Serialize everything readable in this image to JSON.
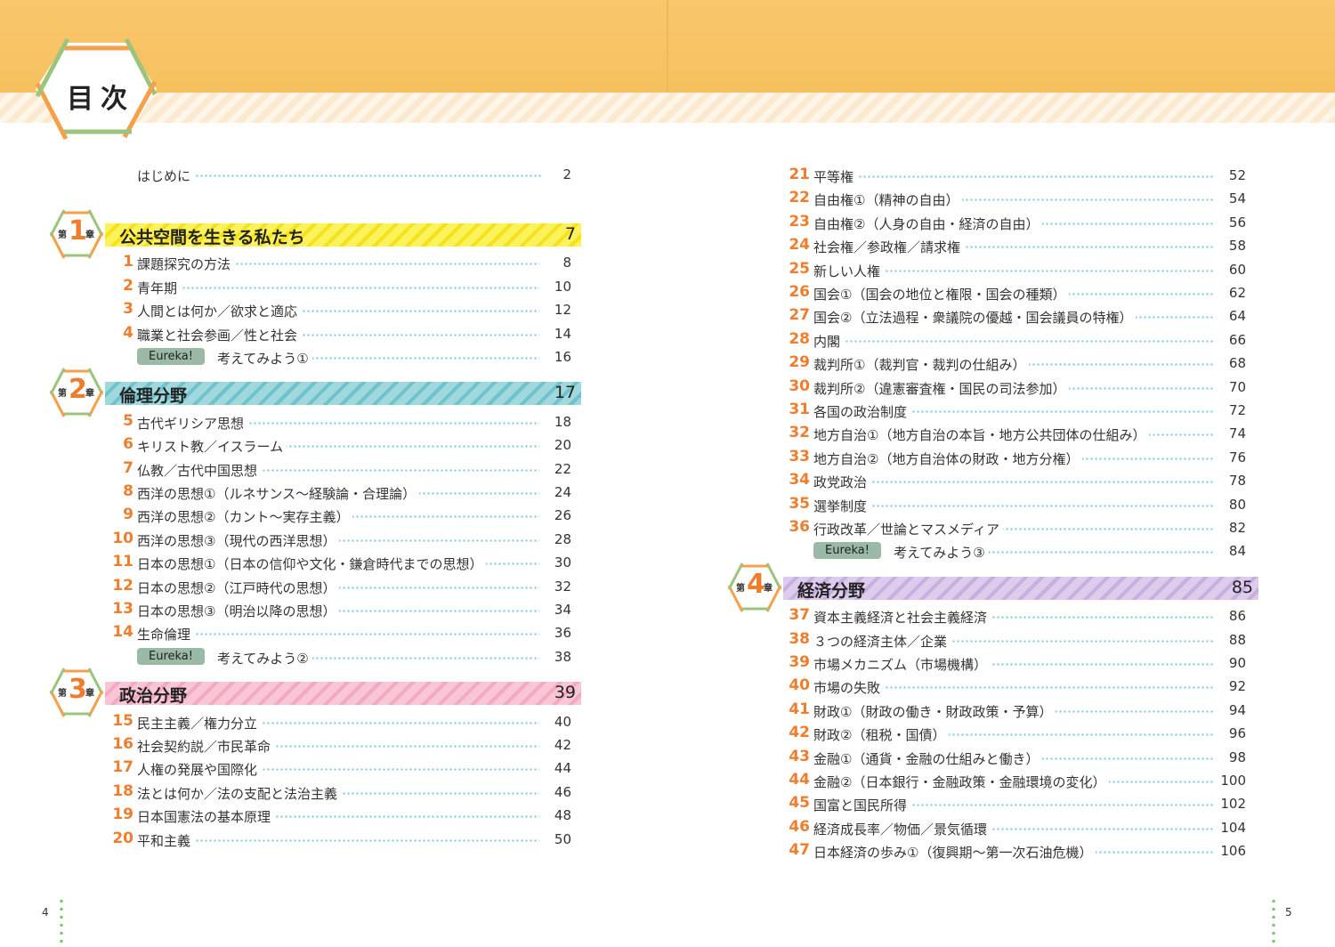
{
  "title": "目次",
  "intro": {
    "label": "はじめに",
    "page": "2"
  },
  "left_column": [
    {
      "kind": "chapter",
      "chapter_num": "1",
      "chapter_prefix": "第",
      "chapter_suffix": "章",
      "title": "公共空間を生きる私たち",
      "page": "7",
      "bar_color": "#fbf35a",
      "accent": "#f6e11c"
    },
    {
      "kind": "item",
      "num": "1",
      "label": "課題探究の方法",
      "page": "8"
    },
    {
      "kind": "item",
      "num": "2",
      "label": "青年期",
      "page": "10"
    },
    {
      "kind": "item",
      "num": "3",
      "label": "人間とは何か／欲求と適応",
      "page": "12"
    },
    {
      "kind": "item",
      "num": "4",
      "label": "職業と社会参画／性と社会",
      "page": "14"
    },
    {
      "kind": "eureka",
      "badge": "Eureka!",
      "label": "考えてみよう①",
      "page": "16"
    },
    {
      "kind": "chapter",
      "chapter_num": "2",
      "chapter_prefix": "第",
      "chapter_suffix": "章",
      "title": "倫理分野",
      "page": "17",
      "bar_color": "#9fd8dd",
      "accent": "#6fc3cc"
    },
    {
      "kind": "item",
      "num": "5",
      "label": "古代ギリシア思想",
      "page": "18"
    },
    {
      "kind": "item",
      "num": "6",
      "label": "キリスト教／イスラーム",
      "page": "20"
    },
    {
      "kind": "item",
      "num": "7",
      "label": "仏教／古代中国思想",
      "page": "22"
    },
    {
      "kind": "item",
      "num": "8",
      "label": "西洋の思想①（ルネサンス〜経験論・合理論）",
      "page": "24"
    },
    {
      "kind": "item",
      "num": "9",
      "label": "西洋の思想②（カント〜実存主義）",
      "page": "26"
    },
    {
      "kind": "item",
      "num": "10",
      "label": "西洋の思想③（現代の西洋思想）",
      "page": "28"
    },
    {
      "kind": "item",
      "num": "11",
      "label": "日本の思想①（日本の信仰や文化・鎌倉時代までの思想）",
      "page": "30"
    },
    {
      "kind": "item",
      "num": "12",
      "label": "日本の思想②（江戸時代の思想）",
      "page": "32"
    },
    {
      "kind": "item",
      "num": "13",
      "label": "日本の思想③（明治以降の思想）",
      "page": "34"
    },
    {
      "kind": "item",
      "num": "14",
      "label": "生命倫理",
      "page": "36"
    },
    {
      "kind": "eureka",
      "badge": "Eureka!",
      "label": "考えてみよう②",
      "page": "38"
    },
    {
      "kind": "chapter",
      "chapter_num": "3",
      "chapter_prefix": "第",
      "chapter_suffix": "章",
      "title": "政治分野",
      "page": "39",
      "bar_color": "#f8c6d6",
      "accent": "#f3a9c0"
    },
    {
      "kind": "item",
      "num": "15",
      "label": "民主主義／権力分立",
      "page": "40"
    },
    {
      "kind": "item",
      "num": "16",
      "label": "社会契約説／市民革命",
      "page": "42"
    },
    {
      "kind": "item",
      "num": "17",
      "label": "人権の発展や国際化",
      "page": "44"
    },
    {
      "kind": "item",
      "num": "18",
      "label": "法とは何か／法の支配と法治主義",
      "page": "46"
    },
    {
      "kind": "item",
      "num": "19",
      "label": "日本国憲法の基本原理",
      "page": "48"
    },
    {
      "kind": "item",
      "num": "20",
      "label": "平和主義",
      "page": "50"
    }
  ],
  "right_column": [
    {
      "kind": "item",
      "num": "21",
      "label": "平等権",
      "page": "52"
    },
    {
      "kind": "item",
      "num": "22",
      "label": "自由権①（精神の自由）",
      "page": "54"
    },
    {
      "kind": "item",
      "num": "23",
      "label": "自由権②（人身の自由・経済の自由）",
      "page": "56"
    },
    {
      "kind": "item",
      "num": "24",
      "label": "社会権／参政権／請求権",
      "page": "58"
    },
    {
      "kind": "item",
      "num": "25",
      "label": "新しい人権",
      "page": "60"
    },
    {
      "kind": "item",
      "num": "26",
      "label": "国会①（国会の地位と権限・国会の種類）",
      "page": "62"
    },
    {
      "kind": "item",
      "num": "27",
      "label": "国会②（立法過程・衆議院の優越・国会議員の特権）",
      "page": "64"
    },
    {
      "kind": "item",
      "num": "28",
      "label": "内閣",
      "page": "66"
    },
    {
      "kind": "item",
      "num": "29",
      "label": "裁判所①（裁判官・裁判の仕組み）",
      "page": "68"
    },
    {
      "kind": "item",
      "num": "30",
      "label": "裁判所②（違憲審査権・国民の司法参加）",
      "page": "70"
    },
    {
      "kind": "item",
      "num": "31",
      "label": "各国の政治制度",
      "page": "72"
    },
    {
      "kind": "item",
      "num": "32",
      "label": "地方自治①（地方自治の本旨・地方公共団体の仕組み）",
      "page": "74"
    },
    {
      "kind": "item",
      "num": "33",
      "label": "地方自治②（地方自治体の財政・地方分権）",
      "page": "76"
    },
    {
      "kind": "item",
      "num": "34",
      "label": "政党政治",
      "page": "78"
    },
    {
      "kind": "item",
      "num": "35",
      "label": "選挙制度",
      "page": "80"
    },
    {
      "kind": "item",
      "num": "36",
      "label": "行政改革／世論とマスメディア",
      "page": "82"
    },
    {
      "kind": "eureka",
      "badge": "Eureka!",
      "label": "考えてみよう③",
      "page": "84"
    },
    {
      "kind": "chapter",
      "chapter_num": "4",
      "chapter_prefix": "第",
      "chapter_suffix": "章",
      "title": "経済分野",
      "page": "85",
      "bar_color": "#ddccec",
      "accent": "#c7b0e0"
    },
    {
      "kind": "item",
      "num": "37",
      "label": "資本主義経済と社会主義経済",
      "page": "86"
    },
    {
      "kind": "item",
      "num": "38",
      "label": "３つの経済主体／企業",
      "page": "88"
    },
    {
      "kind": "item",
      "num": "39",
      "label": "市場メカニズム（市場機構）",
      "page": "90"
    },
    {
      "kind": "item",
      "num": "40",
      "label": "市場の失敗",
      "page": "92"
    },
    {
      "kind": "item",
      "num": "41",
      "label": "財政①（財政の働き・財政政策・予算）",
      "page": "94"
    },
    {
      "kind": "item",
      "num": "42",
      "label": "財政②（租税・国債）",
      "page": "96"
    },
    {
      "kind": "item",
      "num": "43",
      "label": "金融①（通貨・金融の仕組みと働き）",
      "page": "98"
    },
    {
      "kind": "item",
      "num": "44",
      "label": "金融②（日本銀行・金融政策・金融環境の変化）",
      "page": "100"
    },
    {
      "kind": "item",
      "num": "45",
      "label": "国富と国民所得",
      "page": "102"
    },
    {
      "kind": "item",
      "num": "46",
      "label": "経済成長率／物価／景気循環",
      "page": "104"
    },
    {
      "kind": "item",
      "num": "47",
      "label": "日本経済の歩み①（復興期〜第一次石油危機）",
      "page": "106"
    }
  ],
  "page_numbers": {
    "left": "4",
    "right": "5"
  },
  "colors": {
    "header_band": "#f8c465",
    "number_orange": "#ef7d2e",
    "leader_dots": "#8fd0e0",
    "badge_green": "#9cc47d",
    "badge_orange": "#f5a04a"
  }
}
